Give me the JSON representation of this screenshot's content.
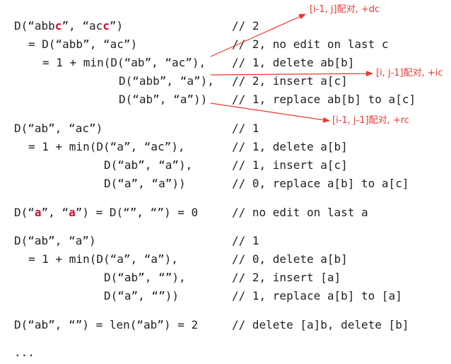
{
  "colors": {
    "text": "#222222",
    "highlight": "#c8102e",
    "arrow": "#e8382f"
  },
  "block1": {
    "l1": {
      "a": "D(“abb",
      "b": "c",
      "c": "”, “ac",
      "d": "c",
      "e": "”)",
      "comment": "// 2"
    },
    "l2": {
      "code": "= D(“abb”, “ac”)",
      "comment": "// 2, no edit on last c"
    },
    "l3": {
      "code": "= 1 + min(D(“ab”, “ac”),",
      "comment": "// 1, delete ab[b]"
    },
    "l4": {
      "code": "D(“abb”, “a”),",
      "comment": "// 2, insert a[c]"
    },
    "l5": {
      "code": "D(“ab”, “a”))",
      "comment": "// 1, replace ab[b] to a[c]"
    }
  },
  "annotations": {
    "a1": "[i-1, j]配对, +dc",
    "a2": "[i, j-1]配对, +ic",
    "a3": "[i-1, j-1]配对, +rc"
  },
  "block2": {
    "l1": {
      "code": "D(“ab”, “ac”)",
      "comment": "// 1"
    },
    "l2": {
      "code": "= 1 + min(D(“a”, “ac”),",
      "comment": "// 1, delete a[b]"
    },
    "l3": {
      "code": "D(“ab”, “a”),",
      "comment": "// 1, insert a[c]"
    },
    "l4": {
      "code": "D(“a”, “a”))",
      "comment": "// 0, replace a[b] to a[c]"
    }
  },
  "block3": {
    "l1": {
      "a": "D(“",
      "b": "a",
      "c": "”, “",
      "d": "a",
      "e": "”) = D(“”, “”) = 0",
      "comment": "// no edit on last a"
    }
  },
  "block4": {
    "l1": {
      "code": "D(“ab”, “a”)",
      "comment": "// 1"
    },
    "l2": {
      "code": "= 1 + min(D(“a”, “a”),",
      "comment": "// 0, delete a[b]"
    },
    "l3": {
      "code": "D(“ab”, “”),",
      "comment": "// 2, insert [a]"
    },
    "l4": {
      "code": "D(“a”, “”))",
      "comment": "// 1, replace a[b] to [a]"
    }
  },
  "block5": {
    "l1": {
      "code": "D(“ab”, “”) = len(“ab”) = 2",
      "comment": "// delete [a]b, delete [b]"
    }
  },
  "ellipsis": "..."
}
